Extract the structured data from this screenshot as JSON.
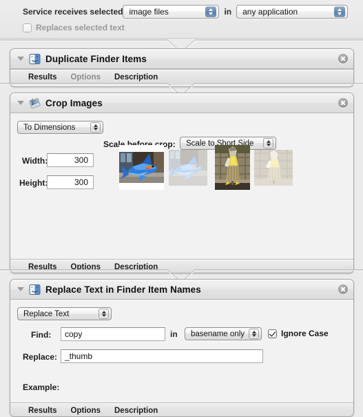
{
  "service_bar": {
    "label": "Service receives selected",
    "input_type": "image files",
    "in_word": "in",
    "application": "any application",
    "replaces_checkbox": {
      "label": "Replaces selected text",
      "checked": false,
      "enabled": false
    }
  },
  "tabs": [
    "Results",
    "Options",
    "Description"
  ],
  "actions": [
    {
      "title": "Duplicate Finder Items",
      "icon": "finder-icon",
      "tabs": [
        "Results",
        "Options",
        "Description"
      ]
    },
    {
      "title": "Crop Images",
      "icon": "preview-crop-icon",
      "mode_popup": "To Dimensions",
      "scale_label": "Scale before crop:",
      "scale_popup": "Scale to Short Side",
      "width_label": "Width:",
      "width_value": "300",
      "height_label": "Height:",
      "height_value": "300",
      "tabs": [
        "Results",
        "Options",
        "Description"
      ]
    },
    {
      "title": "Replace Text in Finder Item Names",
      "icon": "finder-icon",
      "mode_popup": "Replace Text",
      "find_label": "Find:",
      "find_value": "copy",
      "in_word": "in",
      "scope_popup": "basename only",
      "ignore_case_label": "Ignore Case",
      "ignore_case_checked": true,
      "replace_label": "Replace:",
      "replace_value": "_thumb",
      "example_label": "Example:",
      "example_value": "",
      "tabs": [
        "Results",
        "Options",
        "Description"
      ]
    }
  ],
  "colors": {
    "canvas": "#ebebeb",
    "action_bg": "#f2f2f2",
    "header_border": "#a6a6a6",
    "stepper_blue": "#6d8cb3"
  }
}
